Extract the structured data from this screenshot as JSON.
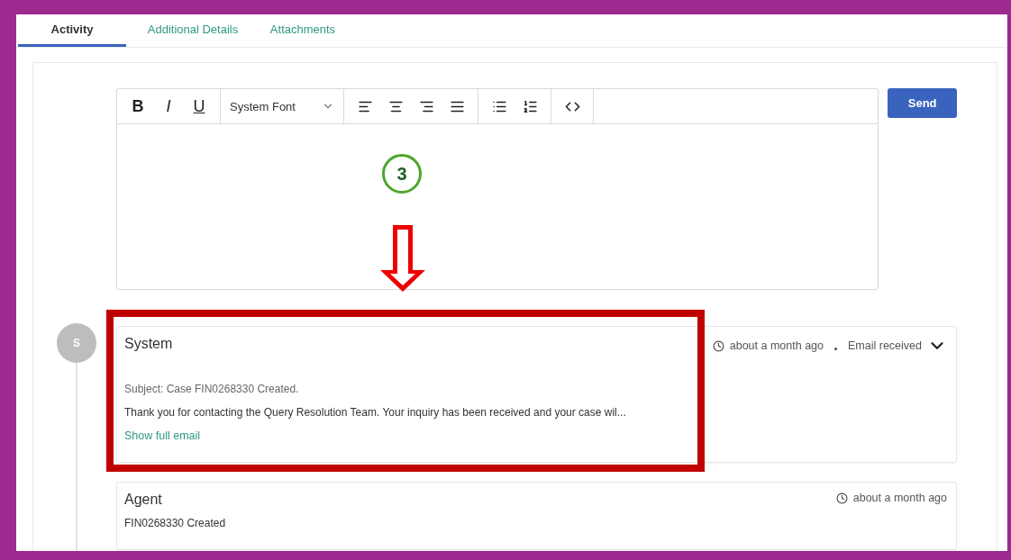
{
  "tabs": [
    {
      "label": "Activity",
      "selected": true
    },
    {
      "label": "Additional Details",
      "selected": false
    },
    {
      "label": "Attachments",
      "selected": false
    }
  ],
  "editor": {
    "format_buttons": [
      "B",
      "I",
      "U"
    ],
    "font": "System Font",
    "send_button": "Send"
  },
  "annotation": {
    "step": "3"
  },
  "timeline": {
    "avatar": "S",
    "entries": [
      {
        "author": "System",
        "time": "about a month ago",
        "type": "Email received",
        "expanded": true,
        "subject": "Subject: Case FIN0268330 Created.",
        "body": "Thank you for contacting the Query Resolution Team. Your inquiry has been received and your case wil...",
        "link": "Show full email"
      },
      {
        "author": "Agent",
        "time": "about a month ago",
        "body": "FIN0268330 Created"
      }
    ]
  }
}
